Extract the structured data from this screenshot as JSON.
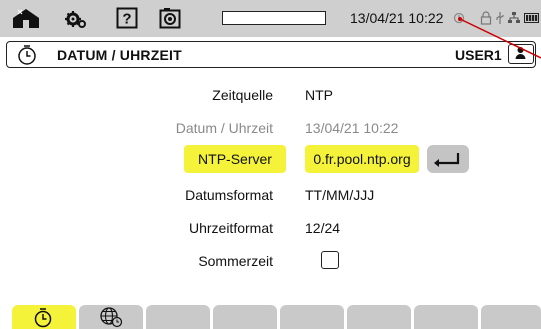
{
  "status_bar": {
    "datetime": "13/04/21 10:22",
    "icons": [
      "home-icon",
      "settings-gears-icon",
      "help-icon",
      "camera-icon",
      "battery-progress",
      "disk-icon",
      "lock-icon",
      "usb-icon",
      "network-icon",
      "battery-icon"
    ]
  },
  "title_bar": {
    "icon": "clock-icon",
    "title": "DATUM / UHRZEIT",
    "user": "USER1",
    "user_icon": "user-icon"
  },
  "form": {
    "zeitquelle": {
      "label": "Zeitquelle",
      "value": "NTP"
    },
    "datum_uhrzeit": {
      "label": "Datum / Uhrzeit",
      "value": "13/04/21 10:22"
    },
    "ntp_server": {
      "label": "NTP-Server",
      "value": "0.fr.pool.ntp.org"
    },
    "datumsformat": {
      "label": "Datumsformat",
      "value": "TT/MM/JJJ"
    },
    "uhrzeitformat": {
      "label": "Uhrzeitformat",
      "value": "12/24"
    },
    "sommerzeit": {
      "label": "Sommerzeit",
      "checked": false
    }
  },
  "tabs": [
    {
      "icon": "clock-icon",
      "active": true
    },
    {
      "icon": "globe-clock-icon",
      "active": false
    },
    {
      "icon": "",
      "active": false
    },
    {
      "icon": "",
      "active": false
    },
    {
      "icon": "",
      "active": false
    },
    {
      "icon": "",
      "active": false
    },
    {
      "icon": "",
      "active": false
    },
    {
      "icon": "",
      "active": false
    }
  ],
  "colors": {
    "highlight": "#f5f23a",
    "status_bar_bg": "#cfcfcf",
    "tab_bg": "#c9c9c9",
    "pointer_line": "#cc0000"
  }
}
